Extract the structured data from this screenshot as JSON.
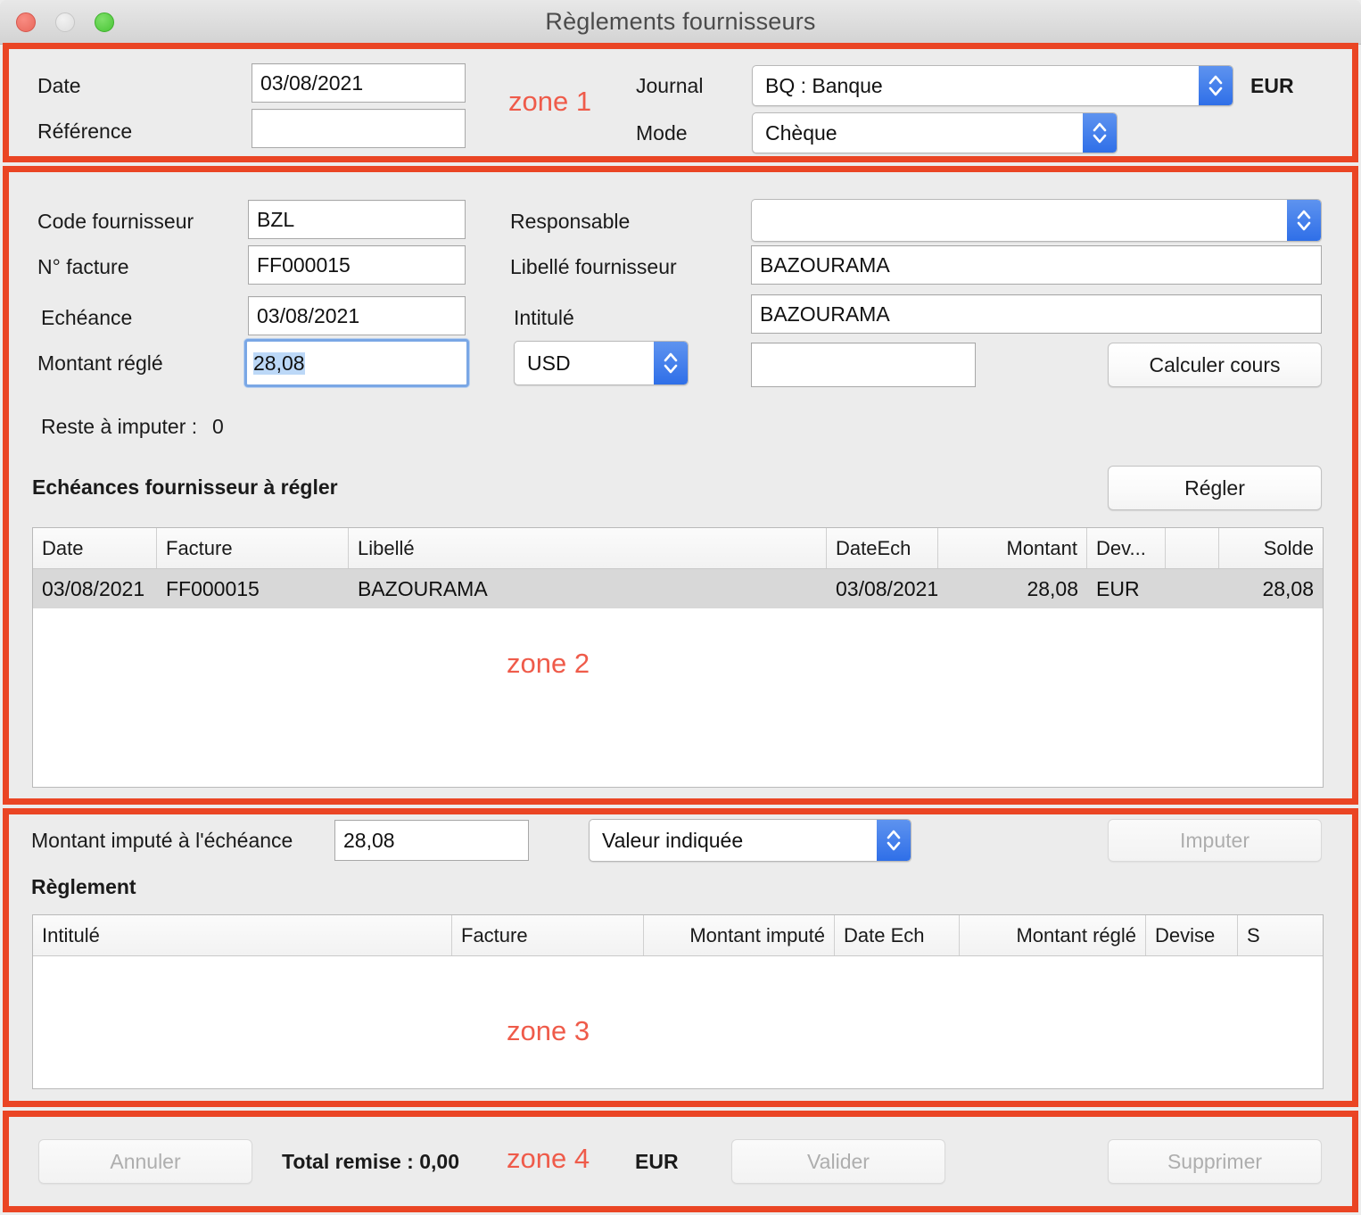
{
  "window": {
    "title": "Règlements fournisseurs",
    "traffic": {
      "close": "close-button",
      "minimize": "minimize-button",
      "zoom": "zoom-button"
    }
  },
  "zone_tags": {
    "z1": "zone 1",
    "z2": "zone 2",
    "z3": "zone 3",
    "z4": "zone 4"
  },
  "zone1": {
    "date_label": "Date",
    "date_value": "03/08/2021",
    "reference_label": "Référence",
    "reference_value": "",
    "journal_label": "Journal",
    "journal_value": "BQ : Banque",
    "currency": "EUR",
    "mode_label": "Mode",
    "mode_value": "Chèque"
  },
  "zone2": {
    "code_fournisseur_label": "Code fournisseur",
    "code_fournisseur_value": "BZL",
    "num_facture_label": "N° facture",
    "num_facture_value": "FF000015",
    "echeance_label": "Echéance",
    "echeance_value": "03/08/2021",
    "montant_regle_label": "Montant réglé",
    "montant_regle_value": "28,08",
    "responsable_label": "Responsable",
    "responsable_value": "",
    "libelle_fournisseur_label": "Libellé fournisseur",
    "libelle_fournisseur_value": "BAZOURAMA",
    "intitule_label": "Intitulé",
    "intitule_value": "BAZOURAMA",
    "devise_value": "USD",
    "cours_value": "",
    "calculer_cours_label": "Calculer cours",
    "reste_a_imputer_label": "Reste à imputer :",
    "reste_a_imputer_value": "0",
    "section_title": "Echéances fournisseur à régler",
    "regler_label": "Régler",
    "table": {
      "columns": [
        "Date",
        "Facture",
        "Libellé",
        "DateEch",
        "Montant",
        "Dev...",
        "",
        "Solde"
      ],
      "rows": [
        [
          "03/08/2021",
          "FF000015",
          "BAZOURAMA",
          "03/08/2021",
          "28,08",
          "EUR",
          "",
          "28,08"
        ]
      ]
    }
  },
  "zone3": {
    "montant_impute_label": "Montant imputé à l'échéance",
    "montant_impute_value": "28,08",
    "valeur_select": "Valeur indiquée",
    "imputer_label": "Imputer",
    "section_title": "Règlement",
    "table": {
      "columns": [
        "Intitulé",
        "Facture",
        "Montant imputé",
        "Date Ech",
        "Montant réglé",
        "Devise",
        "S"
      ],
      "rows": []
    }
  },
  "zone4": {
    "annuler_label": "Annuler",
    "total_remise_label": "Total remise : 0,00",
    "currency": "EUR",
    "valider_label": "Valider",
    "supprimer_label": "Supprimer"
  },
  "colors": {
    "zone_border": "#ea4524",
    "zone_tag_text": "#ef5b4a",
    "stepper_blue": "#2f6fe8",
    "focus_blue": "#7aa7e5",
    "selection_blue": "#bcd8f7",
    "row_selected": "#d8d8d8",
    "panel_bg": "#ececec"
  }
}
